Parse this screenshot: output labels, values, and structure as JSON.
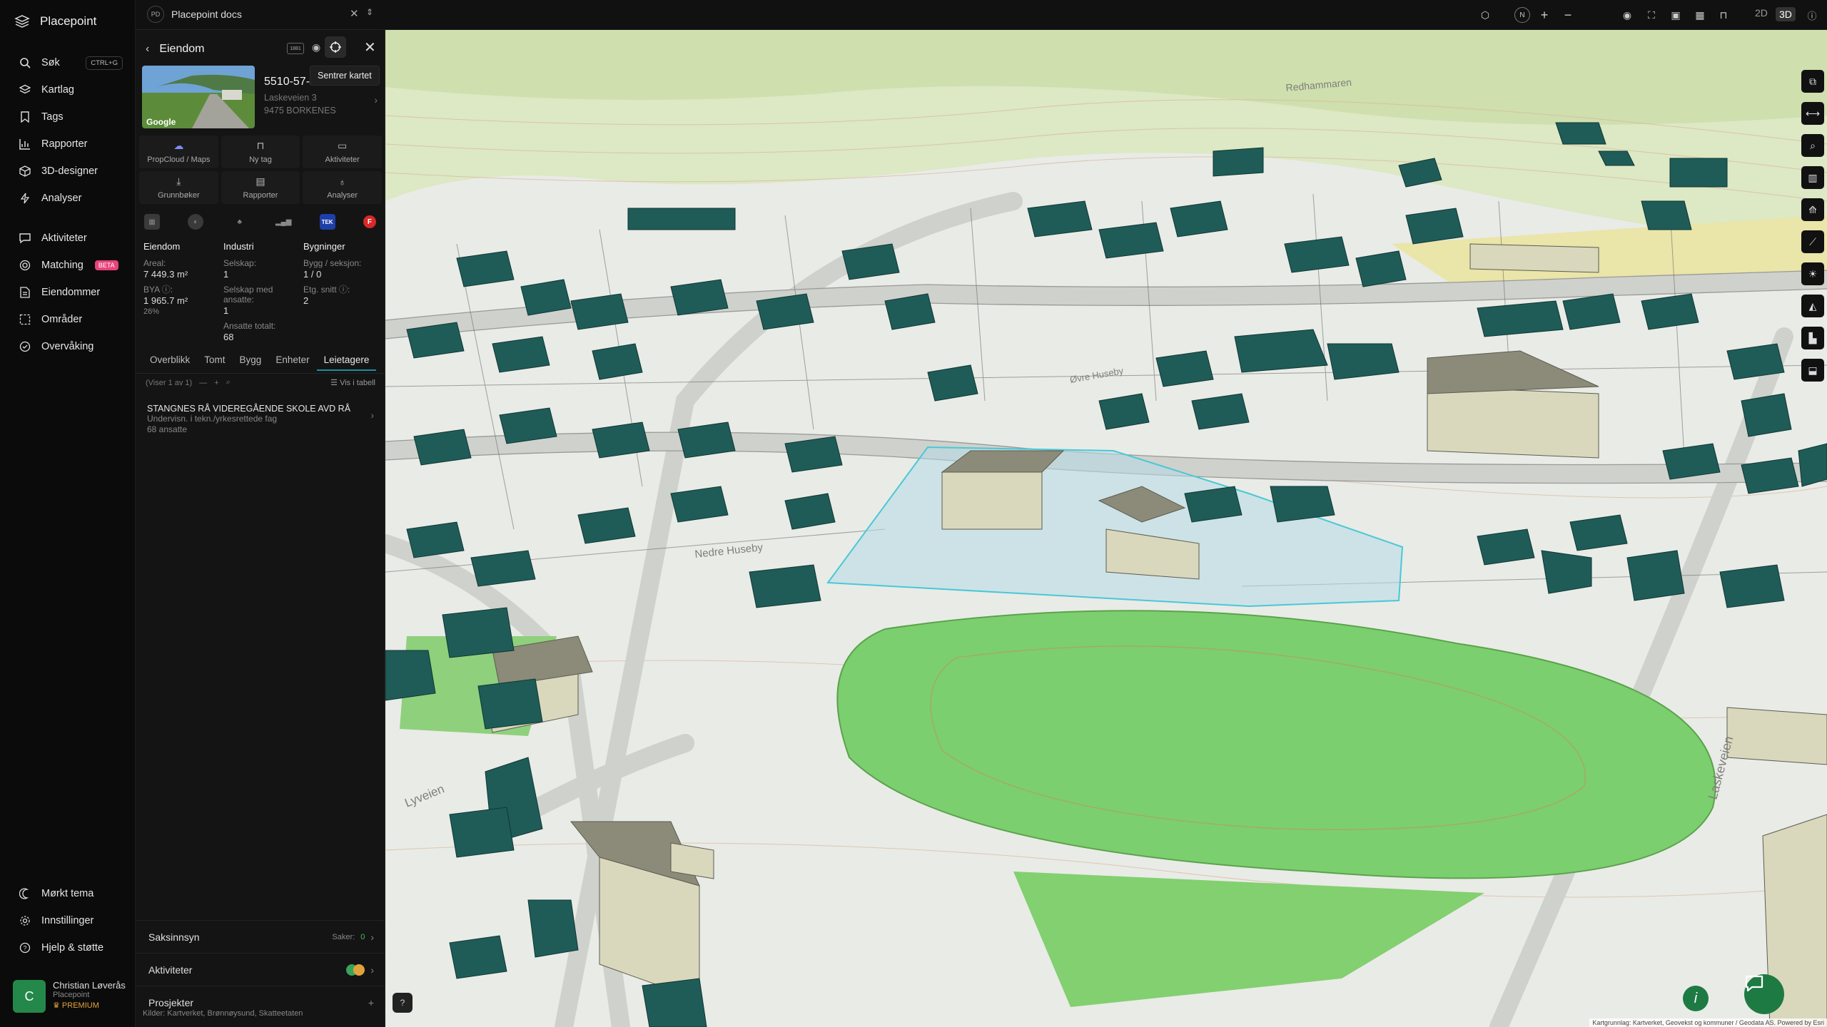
{
  "app": {
    "name": "Placepoint"
  },
  "nav": {
    "items": [
      {
        "label": "Søk",
        "shortcut": "CTRL+G",
        "icon": "search-icon"
      },
      {
        "label": "Kartlag",
        "icon": "layers-icon"
      },
      {
        "label": "Tags",
        "icon": "bookmark-icon"
      },
      {
        "label": "Rapporter",
        "icon": "chart-icon"
      },
      {
        "label": "3D-designer",
        "icon": "cube-icon"
      },
      {
        "label": "Analyser",
        "icon": "bolt-icon"
      },
      {
        "label": "Aktiviteter",
        "icon": "chat-icon"
      },
      {
        "label": "Matching",
        "badge": "BETA",
        "icon": "target-icon"
      },
      {
        "label": "Eiendommer",
        "icon": "document-icon"
      },
      {
        "label": "Områder",
        "icon": "area-icon"
      },
      {
        "label": "Overvåking",
        "icon": "check-circle-icon"
      }
    ],
    "bottom": [
      {
        "label": "Mørkt tema",
        "icon": "moon-icon"
      },
      {
        "label": "Innstillinger",
        "icon": "gear-icon"
      },
      {
        "label": "Hjelp & støtte",
        "icon": "help-icon"
      }
    ],
    "user": {
      "initial": "C",
      "name": "Christian Løverås",
      "org": "Placepoint",
      "plan": "PREMIUM"
    }
  },
  "topbar": {
    "tab_badge": "PD",
    "tab_title": "Placepoint docs",
    "view_2d": "2D",
    "view_3d": "3D",
    "compass": "N"
  },
  "panel": {
    "title": "Eiendom",
    "tooltip": "Sentrer kartet",
    "property_id": "5510-57-220-0-0",
    "address_line1": "Laskeveien 3",
    "address_line2": "9475 BORKENES",
    "image_logo": "Google",
    "quick_actions": [
      {
        "label": "PropCloud / Maps",
        "icon": "cloud-icon"
      },
      {
        "label": "Ny tag",
        "icon": "bookmark-icon"
      },
      {
        "label": "Aktiviteter",
        "icon": "chat-icon"
      },
      {
        "label": "Grunnbøker",
        "icon": "download-icon"
      },
      {
        "label": "Rapporter",
        "icon": "chart-icon"
      },
      {
        "label": "Analyser",
        "icon": "bulb-icon"
      }
    ],
    "source_badges": [
      "TEK",
      "F"
    ],
    "stats": {
      "eiendom": {
        "heading": "Eiendom",
        "areal_label": "Areal:",
        "areal_value": "7 449.3 m²",
        "bya_label": "BYA ⓘ:",
        "bya_value": "1 965.7 m²",
        "bya_pct": "26%"
      },
      "industri": {
        "heading": "Industri",
        "selskap_label": "Selskap:",
        "selskap_value": "1",
        "ansatte_label": "Selskap med ansatte:",
        "ansatte_value": "1",
        "totalt_label": "Ansatte totalt:",
        "totalt_value": "68"
      },
      "bygninger": {
        "heading": "Bygninger",
        "seksjon_label": "Bygg / seksjon:",
        "seksjon_value": "1 / 0",
        "etg_label": "Etg. snitt ⓘ:",
        "etg_value": "2"
      }
    },
    "tabs": [
      "Overblikk",
      "Tomt",
      "Bygg",
      "Enheter",
      "Leietagere"
    ],
    "active_tab": "Leietagere",
    "list_count": "(Viser 1 av 1)",
    "list_view_label": "Vis i tabell",
    "tenant": {
      "name": "STANGNES RÅ VIDEREGÅENDE SKOLE AVD RÅ",
      "desc": "Undervisn. i tekn./yrkesrettede fag",
      "employees": "68 ansatte"
    },
    "sections": [
      {
        "label": "Saksinnsyn",
        "right": "Saker:",
        "count": "0"
      },
      {
        "label": "Aktiviteter"
      },
      {
        "label": "Prosjekter",
        "right": "+"
      }
    ],
    "sources_label": "Kilder:",
    "sources": [
      "Kartverket,",
      "Brønnøysund,",
      "Skatteetaten"
    ]
  },
  "map": {
    "road_labels": [
      "Redhammaren",
      "Øvre Huseby",
      "Nedre Huseby",
      "Laskeveien",
      "Lyveien"
    ],
    "attribution": "Kartgrunnlag: Kartverket, Geovekst og kommuner / Geodata AS. Powered by Esri"
  },
  "colors": {
    "accent": "#1c8fa3",
    "building": "#1f5c57",
    "field": "#7ccf6e",
    "premium": "#e0a33c",
    "beta": "#e8437a"
  }
}
